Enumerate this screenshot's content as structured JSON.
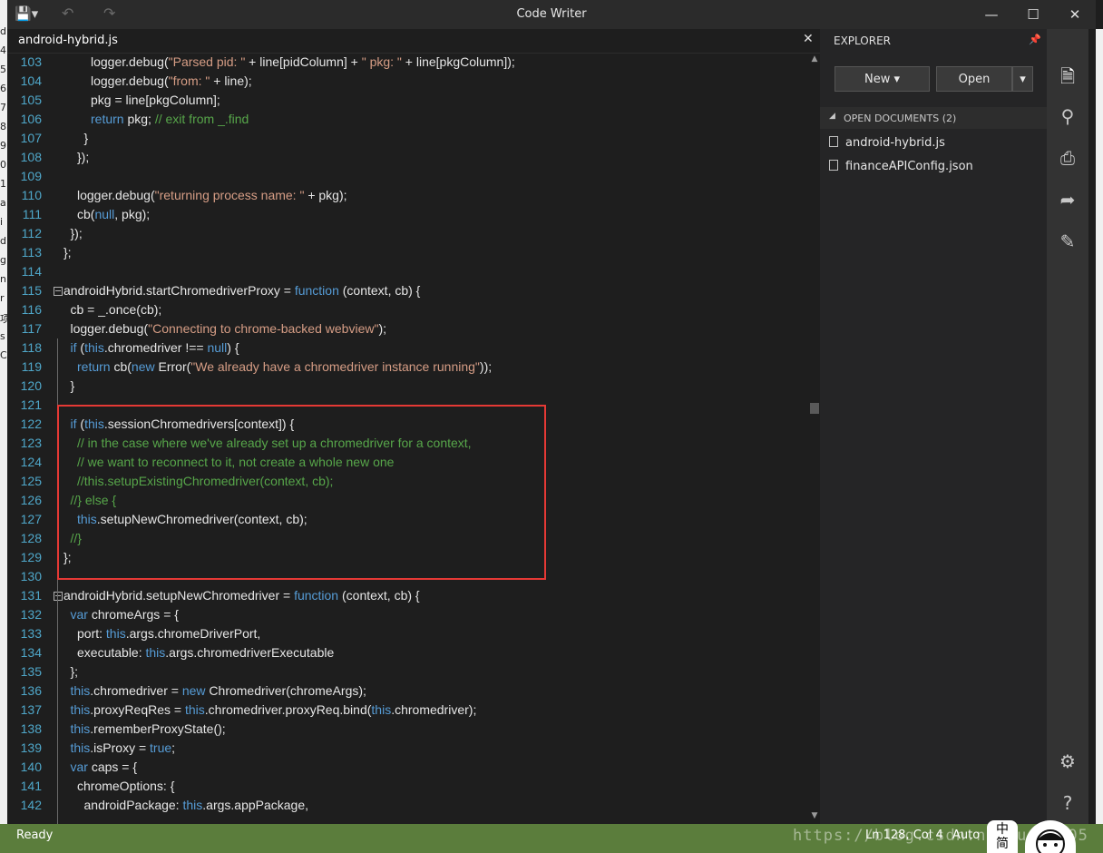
{
  "window": {
    "title": "Code Writer",
    "controls": [
      "minimize-icon",
      "maximize-icon",
      "close-icon"
    ],
    "quick_access": [
      "save-icon",
      "undo-icon",
      "redo-icon"
    ]
  },
  "background_fragments": [
    "d",
    "4",
    "5",
    "6",
    "7",
    "8",
    "9",
    "0",
    "1",
    "a",
    "i",
    "d",
    "g",
    "n",
    "r",
    "项",
    "s",
    "C"
  ],
  "editor": {
    "tab_title": "android-hybrid.js",
    "highlight_color": "#e53935",
    "lines": [
      {
        "n": "103",
        "indent": 5,
        "segments": [
          {
            "t": "logger.debug("
          },
          {
            "t": "\"Parsed pid: \"",
            "c": "str"
          },
          {
            "t": " + line[pidColumn] + "
          },
          {
            "t": "\" pkg: \"",
            "c": "str"
          },
          {
            "t": " + line[pkgColumn]);"
          }
        ]
      },
      {
        "n": "104",
        "indent": 5,
        "segments": [
          {
            "t": "logger.debug("
          },
          {
            "t": "\"from: \"",
            "c": "str"
          },
          {
            "t": " + line);"
          }
        ]
      },
      {
        "n": "105",
        "indent": 5,
        "segments": [
          {
            "t": "pkg = line[pkgColumn];"
          }
        ]
      },
      {
        "n": "106",
        "indent": 5,
        "segments": [
          {
            "t": "return",
            "c": "kw"
          },
          {
            "t": " pkg; "
          },
          {
            "t": "// exit from _.find",
            "c": "cm"
          }
        ]
      },
      {
        "n": "107",
        "indent": 4,
        "segments": [
          {
            "t": "}"
          }
        ]
      },
      {
        "n": "108",
        "indent": 3,
        "segments": [
          {
            "t": "});"
          }
        ]
      },
      {
        "n": "109",
        "indent": 0,
        "segments": []
      },
      {
        "n": "110",
        "indent": 3,
        "segments": [
          {
            "t": "logger.debug("
          },
          {
            "t": "\"returning process name: \"",
            "c": "str"
          },
          {
            "t": " + pkg);"
          }
        ]
      },
      {
        "n": "111",
        "indent": 3,
        "segments": [
          {
            "t": "cb("
          },
          {
            "t": "null",
            "c": "kw"
          },
          {
            "t": ", pkg);"
          }
        ]
      },
      {
        "n": "112",
        "indent": 2,
        "segments": [
          {
            "t": "});"
          }
        ]
      },
      {
        "n": "113",
        "indent": 1,
        "segments": [
          {
            "t": "};"
          }
        ]
      },
      {
        "n": "114",
        "indent": 0,
        "segments": []
      },
      {
        "n": "115",
        "indent": 1,
        "fold": true,
        "segments": [
          {
            "t": "androidHybrid.startChromedriverProxy = "
          },
          {
            "t": "function",
            "c": "kw"
          },
          {
            "t": " (context, cb) {"
          }
        ]
      },
      {
        "n": "116",
        "indent": 2,
        "segments": [
          {
            "t": "cb = _.once(cb);"
          }
        ]
      },
      {
        "n": "117",
        "indent": 2,
        "segments": [
          {
            "t": "logger.debug("
          },
          {
            "t": "\"Connecting to chrome-backed webview\"",
            "c": "str"
          },
          {
            "t": ");"
          }
        ]
      },
      {
        "n": "118",
        "indent": 2,
        "segments": [
          {
            "t": "if",
            "c": "kw"
          },
          {
            "t": " ("
          },
          {
            "t": "this",
            "c": "kw"
          },
          {
            "t": ".chromedriver !== "
          },
          {
            "t": "null",
            "c": "kw"
          },
          {
            "t": ") {"
          }
        ]
      },
      {
        "n": "119",
        "indent": 3,
        "segments": [
          {
            "t": "return",
            "c": "kw"
          },
          {
            "t": " cb("
          },
          {
            "t": "new",
            "c": "kw"
          },
          {
            "t": " Error("
          },
          {
            "t": "\"We already have a chromedriver instance running\"",
            "c": "str"
          },
          {
            "t": "));"
          }
        ]
      },
      {
        "n": "120",
        "indent": 2,
        "segments": [
          {
            "t": "}"
          }
        ]
      },
      {
        "n": "121",
        "indent": 0,
        "segments": []
      },
      {
        "n": "122",
        "indent": 2,
        "segments": [
          {
            "t": "if",
            "c": "kw"
          },
          {
            "t": " ("
          },
          {
            "t": "this",
            "c": "kw"
          },
          {
            "t": ".sessionChromedrivers[context]) {"
          }
        ]
      },
      {
        "n": "123",
        "indent": 3,
        "segments": [
          {
            "t": "// in the case where we've already set up a chromedriver for a context,",
            "c": "cm"
          }
        ]
      },
      {
        "n": "124",
        "indent": 3,
        "segments": [
          {
            "t": "// we want to reconnect to it, not create a whole new one",
            "c": "cm"
          }
        ]
      },
      {
        "n": "125",
        "indent": 3,
        "segments": [
          {
            "t": "//this.setupExistingChromedriver(context, cb);",
            "c": "cm"
          }
        ]
      },
      {
        "n": "126",
        "indent": 2,
        "segments": [
          {
            "t": "//} else {",
            "c": "cm"
          }
        ]
      },
      {
        "n": "127",
        "indent": 3,
        "segments": [
          {
            "t": "this",
            "c": "kw"
          },
          {
            "t": ".setupNewChromedriver(context, cb);"
          }
        ]
      },
      {
        "n": "128",
        "indent": 2,
        "segments": [
          {
            "t": "//}",
            "c": "cm"
          }
        ]
      },
      {
        "n": "129",
        "indent": 1,
        "segments": [
          {
            "t": "};"
          }
        ]
      },
      {
        "n": "130",
        "indent": 0,
        "segments": []
      },
      {
        "n": "131",
        "indent": 1,
        "fold": true,
        "segments": [
          {
            "t": "androidHybrid.setupNewChromedriver = "
          },
          {
            "t": "function",
            "c": "kw"
          },
          {
            "t": " (context, cb) {"
          }
        ]
      },
      {
        "n": "132",
        "indent": 2,
        "segments": [
          {
            "t": "var",
            "c": "kw"
          },
          {
            "t": " chromeArgs = {"
          }
        ]
      },
      {
        "n": "133",
        "indent": 3,
        "segments": [
          {
            "t": "port: "
          },
          {
            "t": "this",
            "c": "kw"
          },
          {
            "t": ".args.chromeDriverPort,"
          }
        ]
      },
      {
        "n": "134",
        "indent": 3,
        "segments": [
          {
            "t": "executable: "
          },
          {
            "t": "this",
            "c": "kw"
          },
          {
            "t": ".args.chromedriverExecutable"
          }
        ]
      },
      {
        "n": "135",
        "indent": 2,
        "segments": [
          {
            "t": "};"
          }
        ]
      },
      {
        "n": "136",
        "indent": 2,
        "segments": [
          {
            "t": "this",
            "c": "kw"
          },
          {
            "t": ".chromedriver = "
          },
          {
            "t": "new",
            "c": "kw"
          },
          {
            "t": " Chromedriver(chromeArgs);"
          }
        ]
      },
      {
        "n": "137",
        "indent": 2,
        "segments": [
          {
            "t": "this",
            "c": "kw"
          },
          {
            "t": ".proxyReqRes = "
          },
          {
            "t": "this",
            "c": "kw"
          },
          {
            "t": ".chromedriver.proxyReq.bind("
          },
          {
            "t": "this",
            "c": "kw"
          },
          {
            "t": ".chromedriver);"
          }
        ]
      },
      {
        "n": "138",
        "indent": 2,
        "segments": [
          {
            "t": "this",
            "c": "kw"
          },
          {
            "t": ".rememberProxyState();"
          }
        ]
      },
      {
        "n": "139",
        "indent": 2,
        "segments": [
          {
            "t": "this",
            "c": "kw"
          },
          {
            "t": ".isProxy = "
          },
          {
            "t": "true",
            "c": "kw"
          },
          {
            "t": ";"
          }
        ]
      },
      {
        "n": "140",
        "indent": 2,
        "segments": [
          {
            "t": "var",
            "c": "kw"
          },
          {
            "t": " caps = {"
          }
        ]
      },
      {
        "n": "141",
        "indent": 3,
        "segments": [
          {
            "t": "chromeOptions: {"
          }
        ]
      },
      {
        "n": "142",
        "indent": 4,
        "segments": [
          {
            "t": "androidPackage: "
          },
          {
            "t": "this",
            "c": "kw"
          },
          {
            "t": ".args.appPackage,"
          }
        ]
      }
    ]
  },
  "explorer": {
    "title": "EXPLORER",
    "new_label": "New",
    "open_label": "Open",
    "section_label": "OPEN DOCUMENTS (2)",
    "documents": [
      "android-hybrid.js",
      "financeAPIConfig.json"
    ]
  },
  "sidebar_icons": [
    "documents-icon",
    "search-icon",
    "print-icon",
    "share-icon",
    "edit-icon",
    "settings-icon",
    "help-icon"
  ],
  "status": {
    "ready": "Ready",
    "position": "Ln 128, Col 4",
    "encoding": "Auto",
    "watermark": "https://blog.csdn.net/u_42_05"
  },
  "ime": {
    "line1": "中",
    "line2": "简"
  }
}
